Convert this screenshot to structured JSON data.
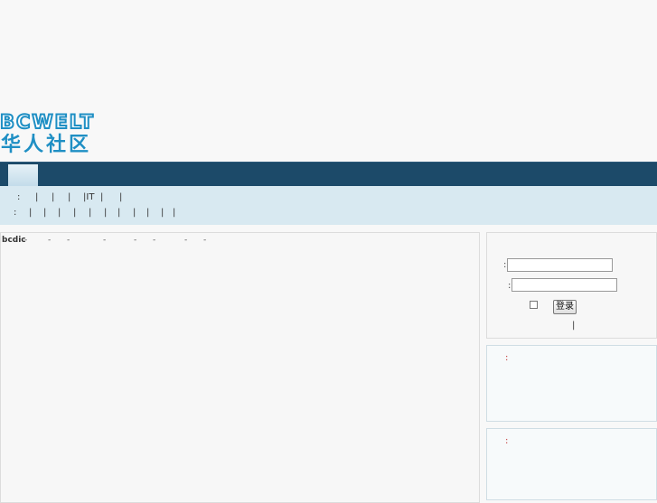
{
  "logo": {
    "text_top": "BCWELT",
    "text_bottom": "华人社区",
    "color": "#1f8fc4"
  },
  "colors": {
    "nav_bg": "#1c4a69",
    "subnav_bg": "#d8e9f1",
    "accent_red": "#c03030"
  },
  "subnav": {
    "row1": [
      ":",
      "|",
      "|",
      "|",
      "|IT",
      "|",
      "|"
    ],
    "row2": [
      ":",
      "|",
      "|",
      "|",
      "|",
      "|",
      "|",
      "|",
      "|",
      "|",
      "|",
      "|"
    ]
  },
  "main": {
    "breadcrumb": {
      "site": "bcdic",
      "separators": [
        "-",
        "-",
        "-",
        "-",
        "-",
        "-",
        "-",
        "-"
      ]
    }
  },
  "login": {
    "user_label": ":",
    "pass_label": ":",
    "user_value": "",
    "pass_value": "",
    "submit_label": "登录",
    "separator": "|"
  },
  "boxes": [
    {
      "label": ":"
    },
    {
      "label": ":"
    }
  ]
}
